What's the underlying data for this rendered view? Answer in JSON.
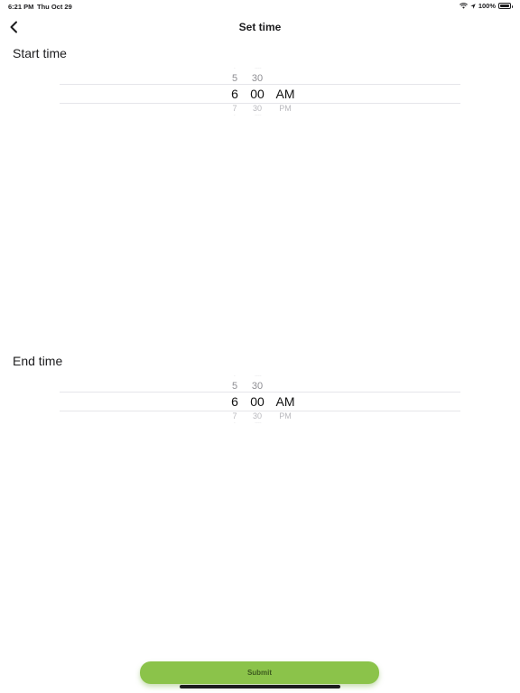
{
  "status_bar": {
    "time": "6:21 PM",
    "date": "Thu Oct 29",
    "battery_text": "100%"
  },
  "nav": {
    "title": "Set time",
    "back_icon": "chevron-left-icon"
  },
  "start_picker": {
    "label": "Start time",
    "hour_above": "5",
    "minute_above": "30",
    "hour_selected": "6",
    "minute_selected": "00",
    "period_selected": "AM",
    "hour_below": "7",
    "minute_below": "30",
    "period_below": "PM"
  },
  "end_picker": {
    "label": "End time",
    "hour_above": "5",
    "minute_above": "30",
    "hour_selected": "6",
    "minute_selected": "00",
    "period_selected": "AM",
    "hour_below": "7",
    "minute_below": "30",
    "period_below": "PM"
  },
  "submit": {
    "label": "Submit",
    "color": "#8bc34a"
  }
}
